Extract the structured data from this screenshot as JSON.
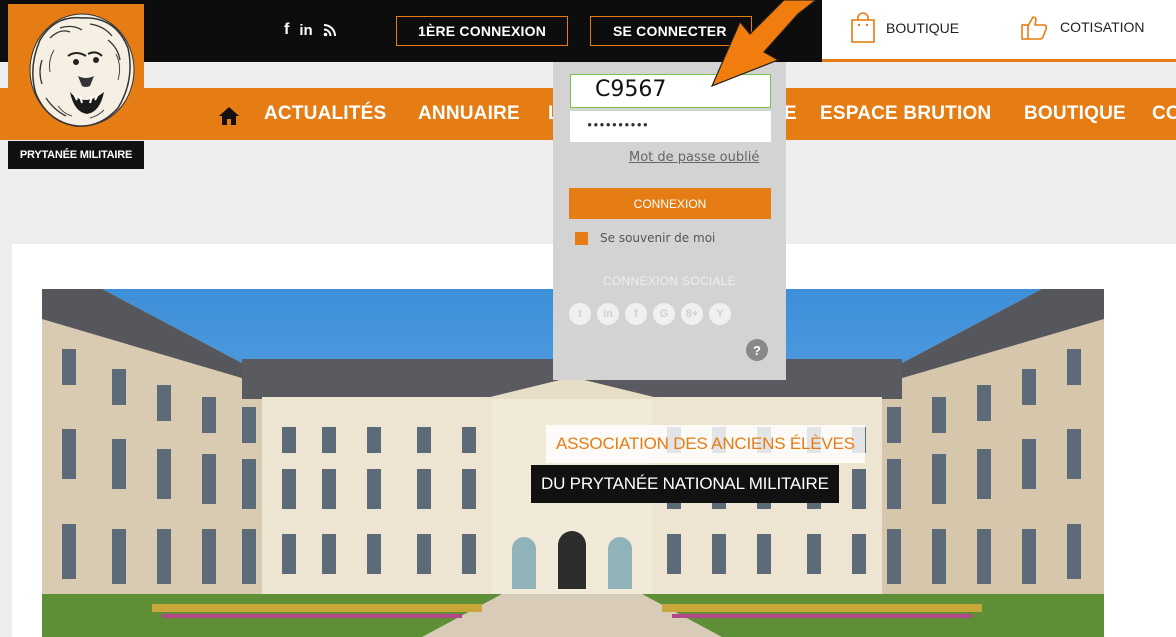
{
  "header": {
    "social_icons": [
      "facebook-icon",
      "linkedin-icon",
      "rss-icon"
    ],
    "social_glyphs": [
      "f",
      "in",
      "⁾"
    ],
    "first_login_label": "1ÈRE CONNEXION",
    "login_label": "SE CONNECTER",
    "shop": [
      {
        "label": "BOUTIQUE",
        "icon": "shopping-bag-icon"
      },
      {
        "label": "COTISATION",
        "icon": "thumbs-up-icon"
      }
    ]
  },
  "logo": {
    "label": "PRYTANÉE MILITAIRE",
    "icon": "lion-logo-icon"
  },
  "nav": {
    "home_icon": "home-icon",
    "items": [
      "ACTUALITÉS",
      "ANNUAIRE",
      "L",
      "E",
      "ESPACE BRUTION",
      "BOUTIQUE",
      "CO"
    ]
  },
  "login_dropdown": {
    "username_value": "C9567",
    "password_value": "••••••••••",
    "forgot_label": "Mot de passe oublié",
    "submit_label": "CONNEXION",
    "remember_label": "Se souvenir de moi",
    "social_title": "CONNEXION SOCIALE",
    "social_buttons": [
      {
        "icon": "twitter-icon",
        "glyph": "t"
      },
      {
        "icon": "linkedin-icon",
        "glyph": "in"
      },
      {
        "icon": "facebook-icon",
        "glyph": "f"
      },
      {
        "icon": "google-icon",
        "glyph": "G"
      },
      {
        "icon": "google-plus-icon",
        "glyph": "8+"
      },
      {
        "icon": "yahoo-icon",
        "glyph": "Y"
      }
    ],
    "help_glyph": "?"
  },
  "hero": {
    "title_line1": "ASSOCIATION DES ANCIENS ÉLÈVES",
    "title_line2": "DU PRYTANÉE NATIONAL MILITAIRE"
  },
  "colors": {
    "accent": "#e67c14",
    "dark": "#0d0d0d",
    "panel": "#d3d3d3"
  }
}
